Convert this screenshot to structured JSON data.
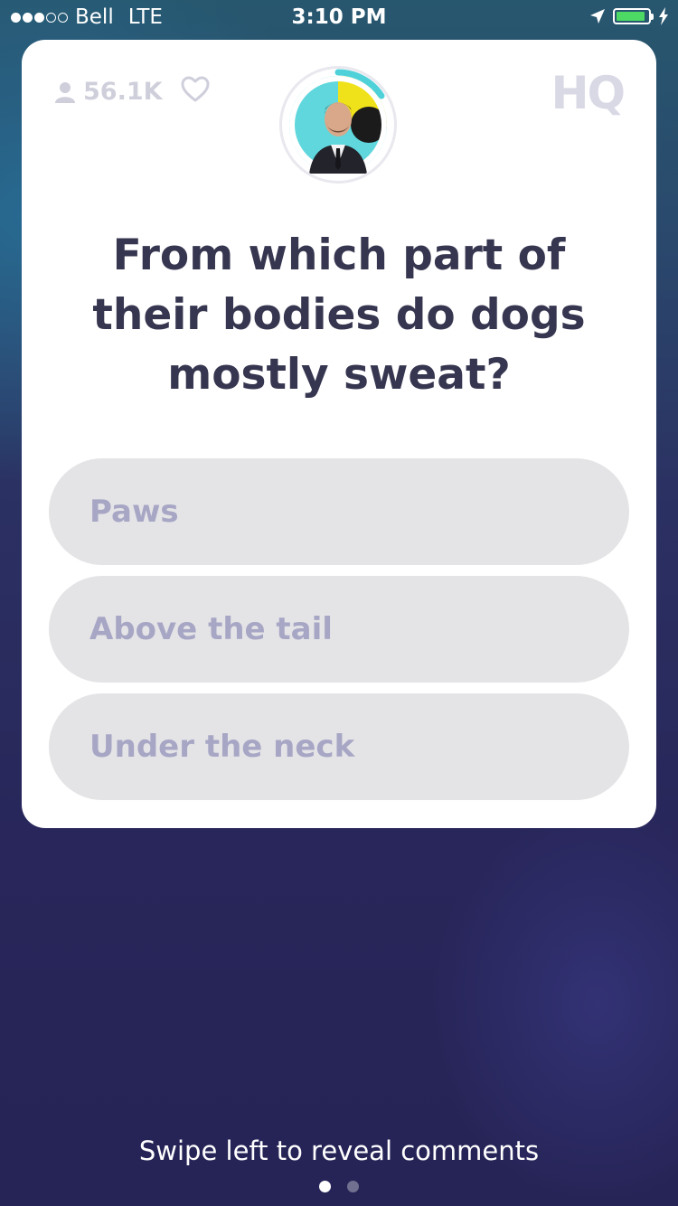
{
  "status_bar": {
    "carrier": "Bell",
    "network": "LTE",
    "time": "3:10 PM",
    "signal_bars_filled": 3,
    "signal_bars_total": 5,
    "battery_fill_fraction": 0.9,
    "icons": [
      "location-arrow-icon",
      "battery-icon",
      "charging-bolt-icon"
    ]
  },
  "card": {
    "viewer_count": "56.1K",
    "logo_text": "HQ",
    "question": "From which part of their bodies do dogs mostly sweat?",
    "answers": [
      {
        "label": "Paws"
      },
      {
        "label": "Above the tail"
      },
      {
        "label": "Under the neck"
      }
    ],
    "timer_remaining_fraction": 0.15,
    "colors": {
      "answer_bg": "#e4e4e7",
      "answer_text": "#a7a6c5",
      "question_text": "#363650",
      "timer_ring": "#4fd1d9"
    }
  },
  "footer": {
    "swipe_hint": "Swipe left to reveal comments",
    "page_count": 2,
    "active_page": 1
  }
}
